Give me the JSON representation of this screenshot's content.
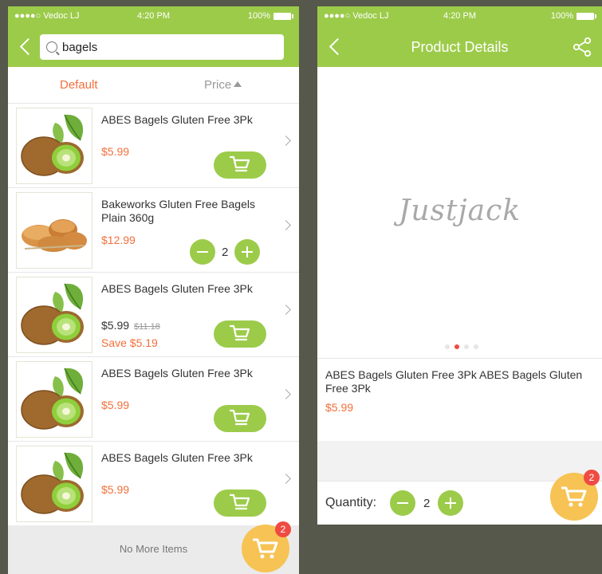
{
  "status": {
    "carrier": "●●●●○ Vedoc LJ",
    "time": "4:20 PM",
    "battery": "100%"
  },
  "search": {
    "query": "bagels"
  },
  "sort": {
    "default_label": "Default",
    "price_label": "Price"
  },
  "items": [
    {
      "title": "ABES Bagels Gluten Free 3Pk",
      "price": "$5.99",
      "image": "kiwi-image",
      "action": "cart"
    },
    {
      "title": "Bakeworks Gluten Free Bagels Plain 360g",
      "price": "$12.99",
      "image": "bread-image",
      "action": "qty",
      "qty": "2"
    },
    {
      "title": "ABES Bagels Gluten Free 3Pk",
      "price": "$5.99",
      "old_price": "$11.18",
      "save": "Save $5.19",
      "image": "kiwi-image",
      "action": "cart"
    },
    {
      "title": "ABES Bagels Gluten Free 3Pk",
      "price": "$5.99",
      "image": "kiwi-image",
      "action": "cart"
    },
    {
      "title": "ABES Bagels Gluten Free 3Pk",
      "price": "$5.99",
      "image": "kiwi-image",
      "action": "cart"
    }
  ],
  "footer": {
    "text": "No More Items"
  },
  "cart_badge": "2",
  "detail": {
    "nav_title": "Product Details",
    "hero_text": "Justjack",
    "title": "ABES Bagels Gluten Free 3Pk ABES Bagels Gluten Free 3Pk",
    "price": "$5.99",
    "qty_label": "Quantity:",
    "qty": "2",
    "cart_badge": "2"
  },
  "colors": {
    "brand_green": "#9ccb4a",
    "price_orange": "#f26f3a",
    "badge_red": "#ef4b43",
    "cart_yellow": "#f6c354"
  }
}
